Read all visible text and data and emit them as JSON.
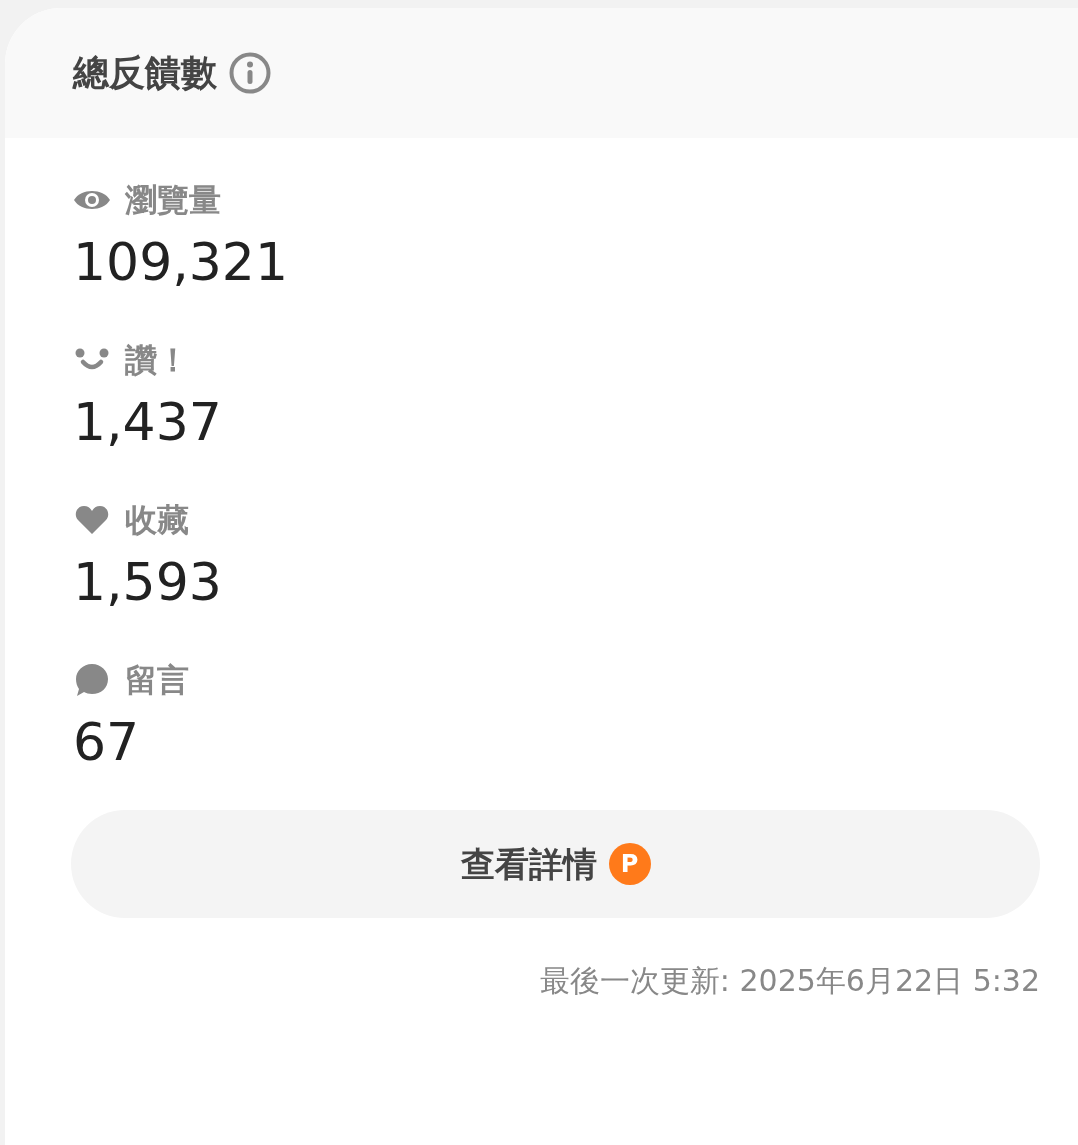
{
  "header": {
    "title": "總反饋數"
  },
  "stats": [
    {
      "kind": "views",
      "label": "瀏覽量",
      "value": "109,321"
    },
    {
      "kind": "likes",
      "label": "讚！",
      "value": "1,437"
    },
    {
      "kind": "saves",
      "label": "收藏",
      "value": "1,593"
    },
    {
      "kind": "comments",
      "label": "留言",
      "value": "67"
    }
  ],
  "details_button": {
    "label": "查看詳情",
    "badge": "P"
  },
  "last_updated": "最後一次更新: 2025年6月22日 5:32"
}
